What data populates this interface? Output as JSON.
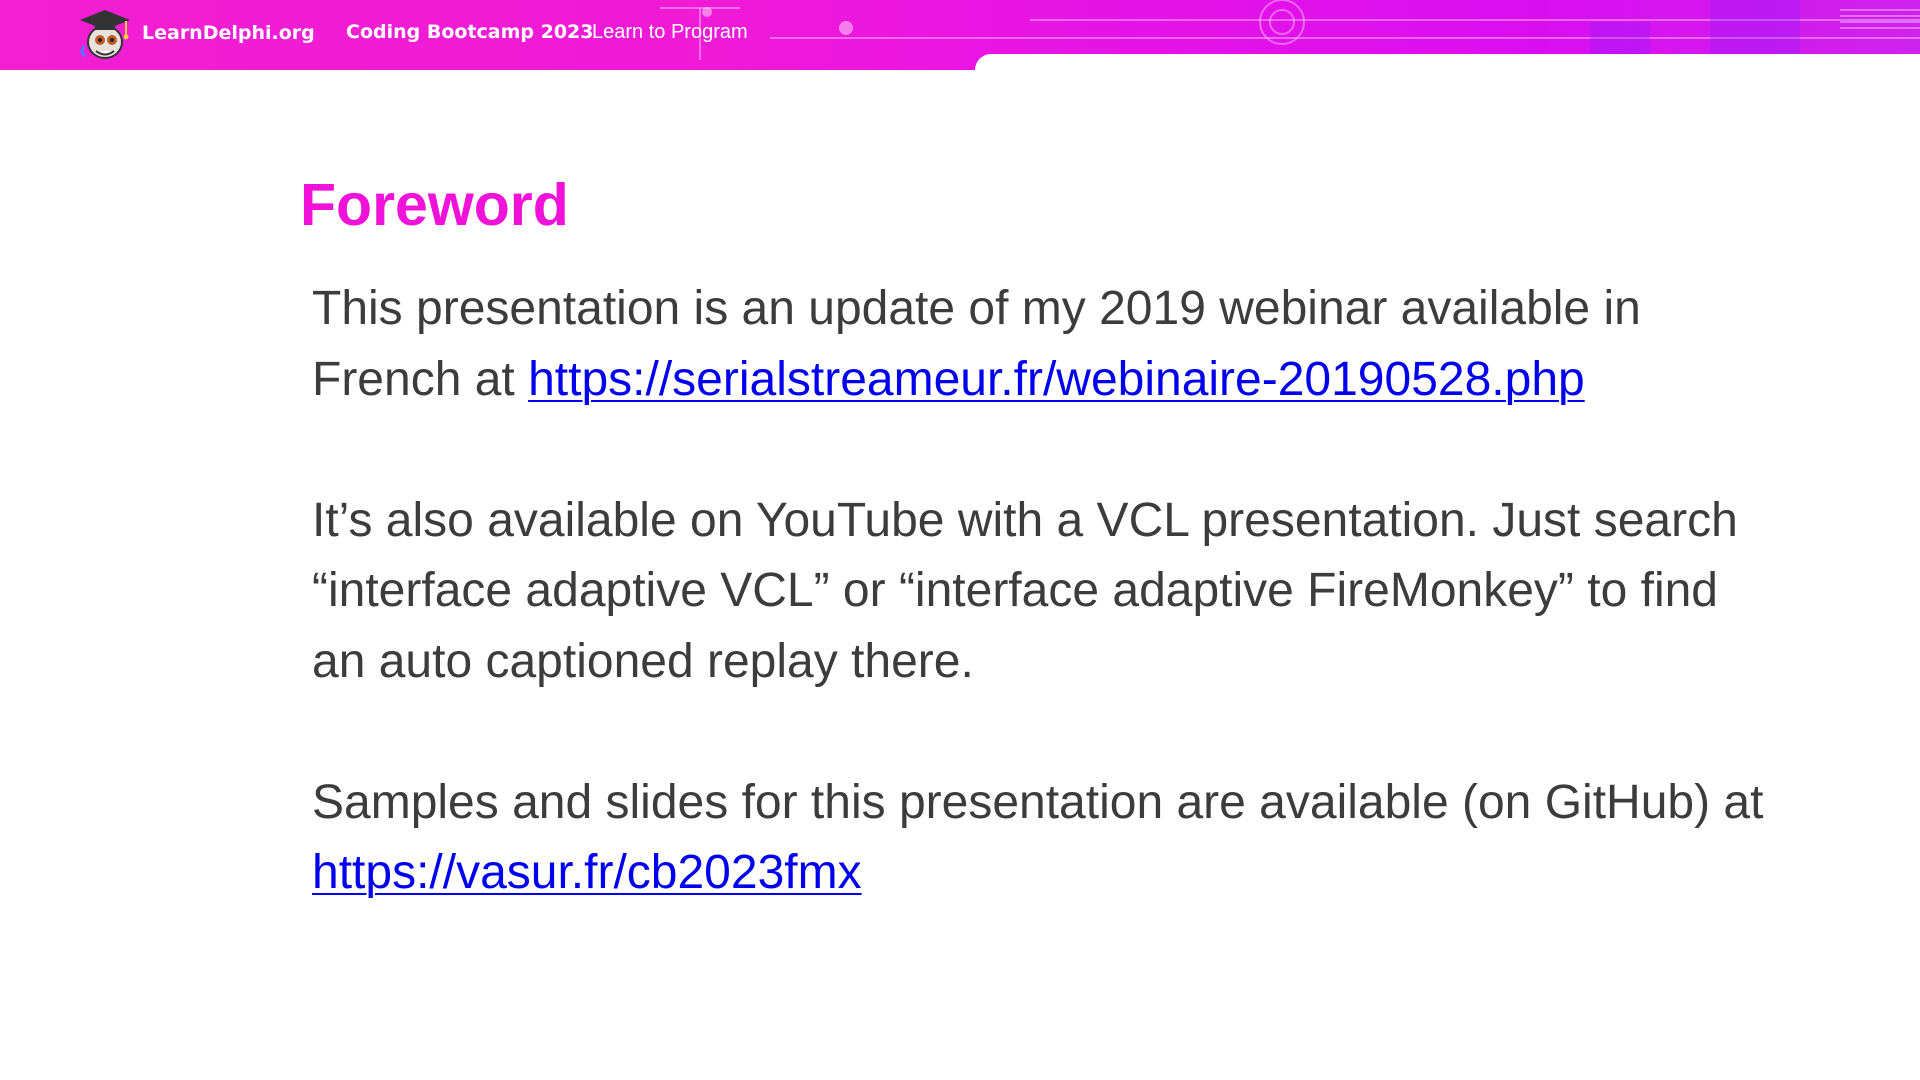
{
  "header": {
    "brand": "LearnDelphi.org",
    "course_title": "Coding Bootcamp 2023",
    "course_subtitle": "Learn to Program",
    "logo_icon": "graduation-mascot-icon",
    "colors": {
      "banner": "#f21fd3",
      "banner_end": "#cf22ee"
    }
  },
  "slide": {
    "title": "Foreword",
    "title_color": "#f012d9",
    "text_color": "#3c3c3c",
    "link_color": "#0000ee",
    "p1_line1": "This presentation is an update of my 2019 webinar available in",
    "p1_line2_prefix": "French at ",
    "p1_link": "https://serialstreameur.fr/webinaire-20190528.php",
    "p2_line1": "It’s also available on YouTube with a VCL presentation. Just search",
    "p2_line2": "“interface adaptive VCL” or “interface adaptive FireMonkey” to find",
    "p2_line3": "an auto captioned replay there.",
    "p3_line1": "Samples and slides for this presentation are available (on GitHub) at",
    "p3_link": "https://vasur.fr/cb2023fmx"
  }
}
